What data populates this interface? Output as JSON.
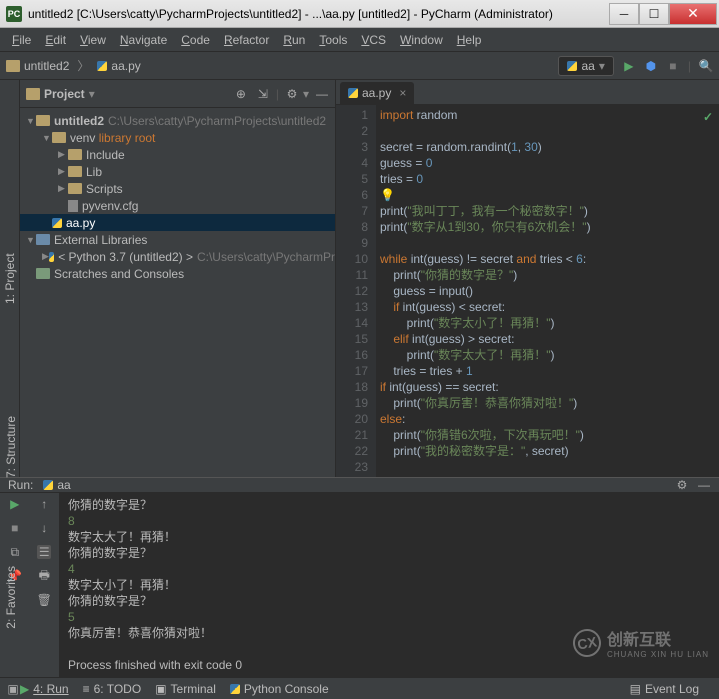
{
  "window": {
    "title": "untitled2 [C:\\Users\\catty\\PycharmProjects\\untitled2] - ...\\aa.py [untitled2] - PyCharm (Administrator)"
  },
  "menu": [
    "File",
    "Edit",
    "View",
    "Navigate",
    "Code",
    "Refactor",
    "Run",
    "Tools",
    "VCS",
    "Window",
    "Help"
  ],
  "breadcrumb": {
    "root": "untitled2",
    "file": "aa.py"
  },
  "runconfig": {
    "label": "aa"
  },
  "project_panel": {
    "title": "Project"
  },
  "tree": {
    "root": "untitled2",
    "root_path": "C:\\Users\\catty\\PycharmProjects\\untitled2",
    "venv": "venv",
    "venv_hint": "library root",
    "include": "Include",
    "lib": "Lib",
    "scripts": "Scripts",
    "pyvenv": "pyvenv.cfg",
    "aa": "aa.py",
    "extlib": "External Libraries",
    "py37": "< Python 3.7 (untitled2) >",
    "py37_path": "C:\\Users\\catty\\PycharmPr",
    "scratch": "Scratches and Consoles"
  },
  "editor_tab": "aa.py",
  "code_lines": {
    "l1a": "import",
    "l1b": " random",
    "l3": "secret = random.randint(",
    "l3n1": "1",
    "l3c": ", ",
    "l3n2": "30",
    "l3e": ")",
    "l4": "guess = ",
    "l4n": "0",
    "l5": "tries = ",
    "l5n": "0",
    "l7a": "print",
    "l7b": "(",
    "l7s": "\"我叫丁丁，我有一个秘密数字！\"",
    "l7e": ")",
    "l8a": "print",
    "l8b": "(",
    "l8s": "\"数字从1到30，你只有6次机会！\"",
    "l8e": ")",
    "l10a": "while",
    "l10b": " int(guess) != secret ",
    "l10c": "and",
    "l10d": " tries < ",
    "l10n": "6",
    "l10e": ":",
    "l11a": "print",
    "l11b": "(",
    "l11s": "\"你猜的数字是？\"",
    "l11e": ")",
    "l12": "    guess = input()",
    "l13a": "if",
    "l13b": " int(guess) < secret:",
    "l14a": "print",
    "l14b": "(",
    "l14s": "\"数字太小了！再猜！\"",
    "l14e": ")",
    "l15a": "elif",
    "l15b": " int(guess) > secret:",
    "l16a": "print",
    "l16b": "(",
    "l16s": "\"数字太大了！再猜！\"",
    "l16e": ")",
    "l17": "    tries = tries + ",
    "l17n": "1",
    "l18a": "if",
    "l18b": " int(guess) == secret:",
    "l19a": "print",
    "l19b": "(",
    "l19s": "\"你真厉害！恭喜你猜对啦！\"",
    "l19e": ")",
    "l20a": "else",
    "l20e": ":",
    "l21a": "print",
    "l21b": "(",
    "l21s": "\"你猜错6次啦，下次再玩吧！\"",
    "l21e": ")",
    "l22a": "print",
    "l22b": "(",
    "l22s": "\"我的秘密数字是：\"",
    "l22c": ", secret)"
  },
  "gutter": [
    "1",
    "2",
    "3",
    "4",
    "5",
    "6",
    "7",
    "8",
    "9",
    "10",
    "11",
    "12",
    "13",
    "14",
    "15",
    "16",
    "17",
    "18",
    "19",
    "20",
    "21",
    "22",
    "23"
  ],
  "run": {
    "title": "Run:",
    "label": "aa",
    "out": [
      {
        "t": "你猜的数字是？",
        "c": ""
      },
      {
        "t": "8",
        "c": "inp"
      },
      {
        "t": "数字太大了！再猜！",
        "c": ""
      },
      {
        "t": "你猜的数字是？",
        "c": ""
      },
      {
        "t": "4",
        "c": "inp"
      },
      {
        "t": "数字太小了！再猜！",
        "c": ""
      },
      {
        "t": "你猜的数字是？",
        "c": ""
      },
      {
        "t": "5",
        "c": "inp"
      },
      {
        "t": "你真厉害！恭喜你猜对啦！",
        "c": ""
      },
      {
        "t": "",
        "c": ""
      },
      {
        "t": "Process finished with exit code 0",
        "c": ""
      }
    ]
  },
  "status": {
    "run": "4: Run",
    "todo": "6: TODO",
    "terminal": "Terminal",
    "pyconsole": "Python Console",
    "eventlog": "Event Log"
  },
  "siderail": {
    "project": "1: Project",
    "structure": "7: Structure",
    "favorites": "2: Favorites"
  },
  "watermark": {
    "brand": "创新互联",
    "sub1": "CHUANG XIN HU LIAN"
  }
}
